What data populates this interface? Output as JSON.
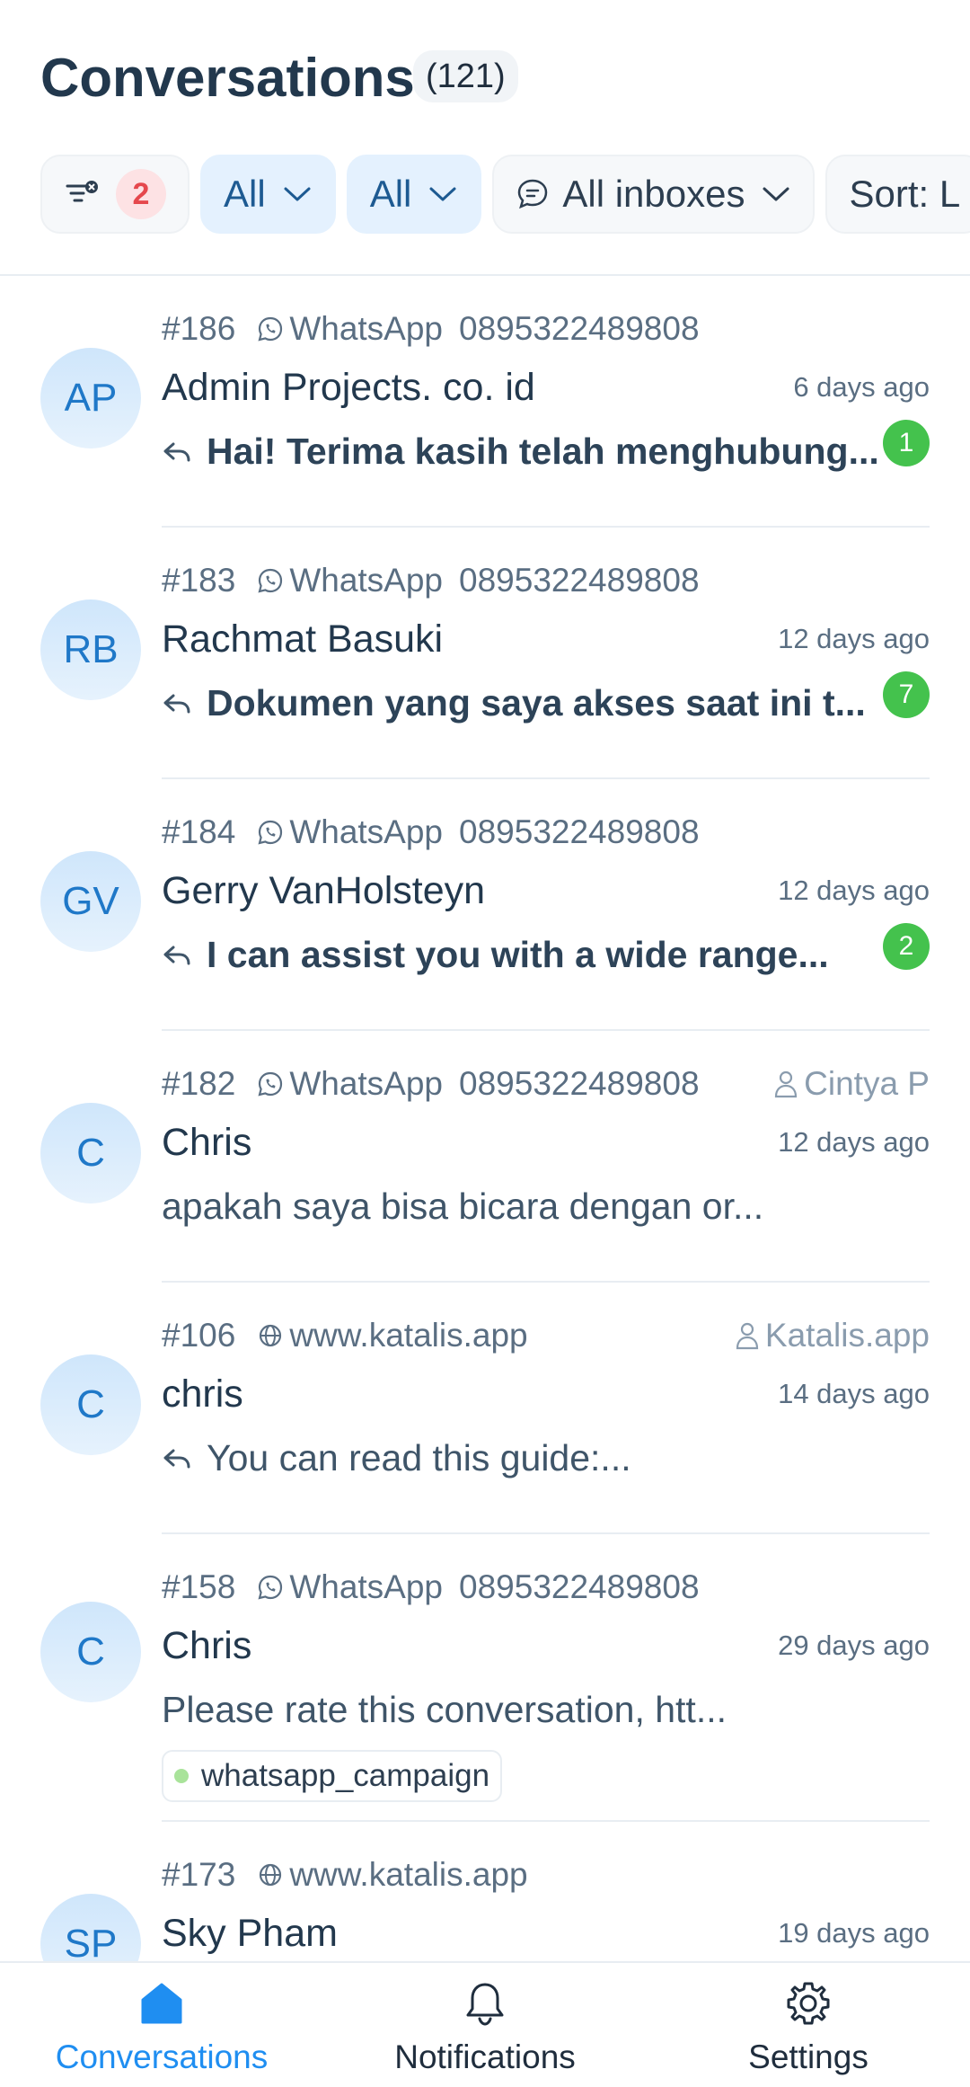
{
  "header": {
    "title": "Conversations",
    "count": "(121)",
    "filter_badge": "2",
    "chips": [
      {
        "label": "All"
      },
      {
        "label": "All"
      },
      {
        "label": "All inboxes"
      },
      {
        "label": "Sort: L"
      }
    ]
  },
  "conversations": [
    {
      "id": "#186",
      "channel": "WhatsApp",
      "channel_icon": "whatsapp-icon",
      "phone": "0895322489808",
      "assignee": "",
      "initials": "AP",
      "name": "Admin Projects. co. id",
      "time": "6 days ago",
      "message": "Hai! Terima kasih telah menghubung...",
      "replied": true,
      "unread": "1",
      "label": ""
    },
    {
      "id": "#183",
      "channel": "WhatsApp",
      "channel_icon": "whatsapp-icon",
      "phone": "0895322489808",
      "assignee": "",
      "initials": "RB",
      "name": "Rachmat Basuki",
      "time": "12 days ago",
      "message": "Dokumen yang saya akses saat ini t...",
      "replied": true,
      "unread": "7",
      "label": ""
    },
    {
      "id": "#184",
      "channel": "WhatsApp",
      "channel_icon": "whatsapp-icon",
      "phone": "0895322489808",
      "assignee": "",
      "initials": "GV",
      "name": "Gerry VanHolsteyn",
      "time": "12 days ago",
      "message": "I can assist you with a wide range...",
      "replied": true,
      "unread": "2",
      "label": ""
    },
    {
      "id": "#182",
      "channel": "WhatsApp",
      "channel_icon": "whatsapp-icon",
      "phone": "0895322489808",
      "assignee": "Cintya P",
      "initials": "C",
      "name": "Chris",
      "time": "12 days ago",
      "message": "apakah saya bisa  bicara dengan or...",
      "replied": false,
      "unread": "",
      "label": ""
    },
    {
      "id": "#106",
      "channel": "www.katalis.app",
      "channel_icon": "globe-icon",
      "phone": "",
      "assignee": "Katalis.app",
      "initials": "C",
      "name": "chris",
      "time": "14 days ago",
      "message": "You can read this guide:...",
      "replied": true,
      "unread": "",
      "label": ""
    },
    {
      "id": "#158",
      "channel": "WhatsApp",
      "channel_icon": "whatsapp-icon",
      "phone": "0895322489808",
      "assignee": "",
      "initials": "C",
      "name": "Chris",
      "time": "29 days ago",
      "message": "Please rate this conversation, htt...",
      "replied": false,
      "unread": "",
      "label": "whatsapp_campaign"
    },
    {
      "id": "#173",
      "channel": "www.katalis.app",
      "channel_icon": "globe-icon",
      "phone": "",
      "assignee": "",
      "initials": "SP",
      "name": "Sky Pham",
      "time": "19 days ago",
      "message": "",
      "replied": false,
      "unread": "",
      "label": ""
    }
  ],
  "nav": {
    "items": [
      {
        "label": "Conversations",
        "icon": "home-icon",
        "active": true
      },
      {
        "label": "Notifications",
        "icon": "bell-icon",
        "active": false
      },
      {
        "label": "Settings",
        "icon": "gear-icon",
        "active": false
      }
    ]
  },
  "colors": {
    "accent": "#1f8ef1",
    "unread": "#44c24d",
    "filter_badge": "#e5484d"
  }
}
